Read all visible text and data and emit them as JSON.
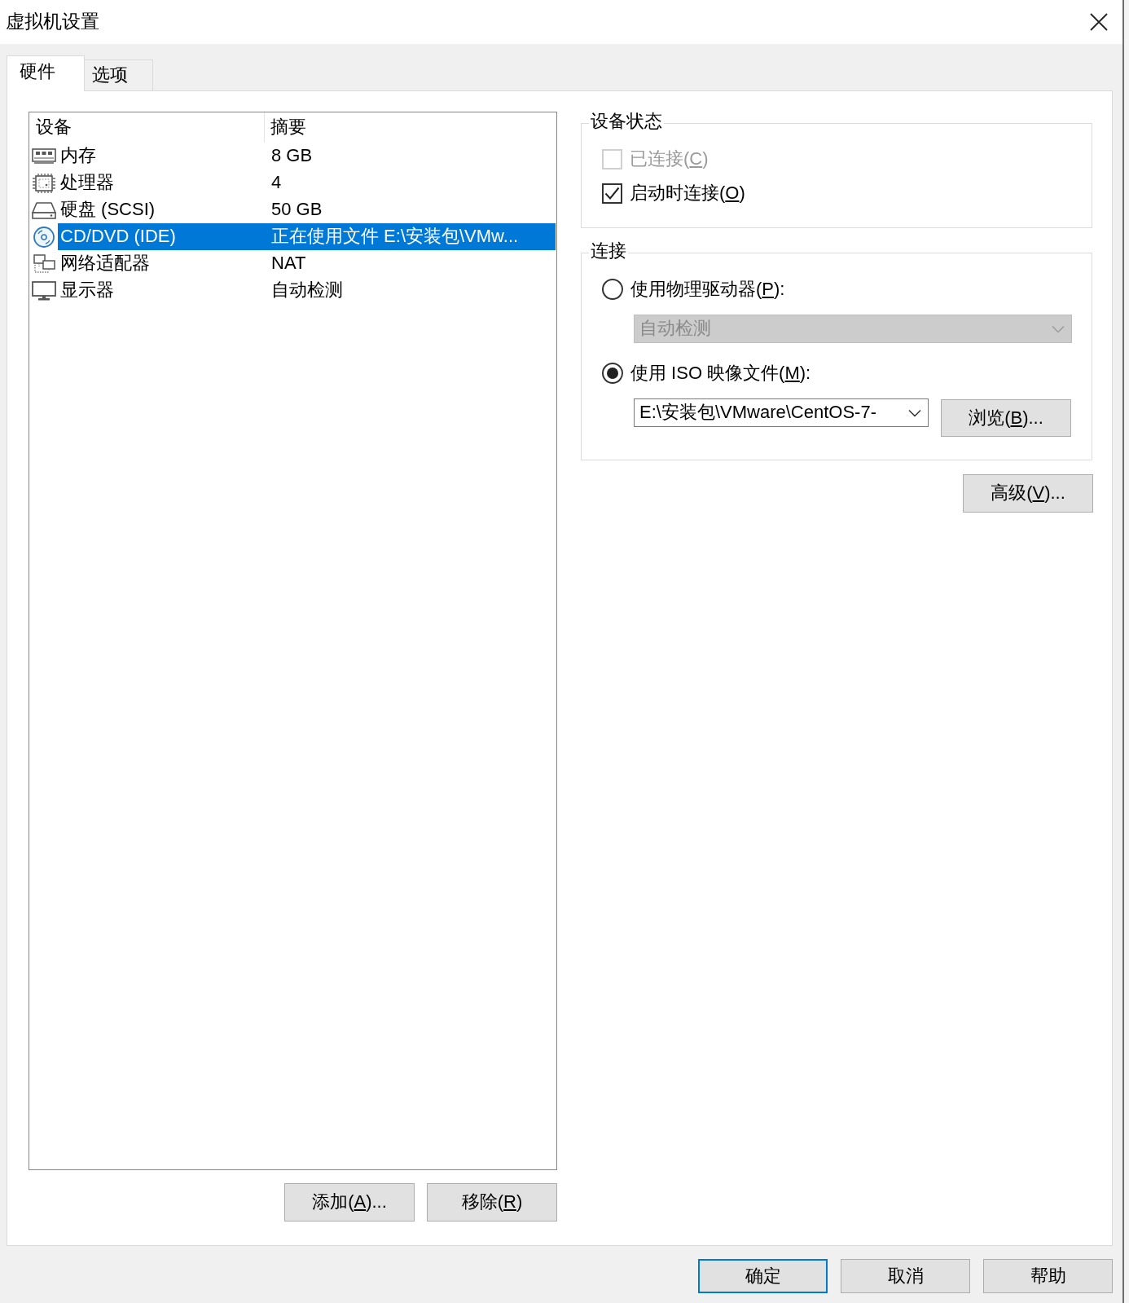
{
  "window": {
    "title": "虚拟机设置"
  },
  "tabs": [
    {
      "label": "硬件",
      "selected": true
    },
    {
      "label": "选项",
      "selected": false
    }
  ],
  "device_list": {
    "columns": [
      "设备",
      "摘要"
    ],
    "rows": [
      {
        "kind": "memory",
        "device": "内存",
        "summary": "8 GB",
        "selected": false
      },
      {
        "kind": "processor",
        "device": "处理器",
        "summary": "4",
        "selected": false
      },
      {
        "kind": "hard_disk",
        "device": "硬盘 (SCSI)",
        "summary": "50 GB",
        "selected": false
      },
      {
        "kind": "cd_dvd",
        "device": "CD/DVD (IDE)",
        "summary": "正在使用文件 E:\\安装包\\VMw...",
        "selected": true
      },
      {
        "kind": "network",
        "device": "网络适配器",
        "summary": "NAT",
        "selected": false
      },
      {
        "kind": "display",
        "device": "显示器",
        "summary": "自动检测",
        "selected": false
      }
    ]
  },
  "list_buttons": [
    {
      "label": [
        "添加(",
        "A",
        ")..."
      ]
    },
    {
      "label": [
        "移除(",
        "R",
        ")"
      ]
    }
  ],
  "device_status": {
    "title": "设备状态",
    "options": [
      {
        "label": [
          "已连接(",
          "C",
          ")"
        ],
        "checked": false,
        "disabled": true
      },
      {
        "label": [
          "启动时连接(",
          "O",
          ")"
        ],
        "checked": true,
        "disabled": false
      }
    ]
  },
  "connection": {
    "title": "连接",
    "sources": [
      {
        "label": [
          "使用物理驱动器(",
          "P",
          "):"
        ],
        "selected": false,
        "field": {
          "value": "自动检测",
          "disabled": true
        }
      },
      {
        "label": [
          "使用 ISO 映像文件(",
          "M",
          "):"
        ],
        "selected": true,
        "field": {
          "value": "E:\\安装包\\VMware\\CentOS-7-",
          "disabled": false
        },
        "browse_button": [
          "浏览(",
          "B",
          ")..."
        ]
      }
    ]
  },
  "advanced_button": [
    "高级(",
    "V",
    ")..."
  ],
  "dialog_buttons": [
    {
      "label": "确定",
      "default": true
    },
    {
      "label": "取消",
      "default": false
    },
    {
      "label": "帮助",
      "default": false
    }
  ]
}
